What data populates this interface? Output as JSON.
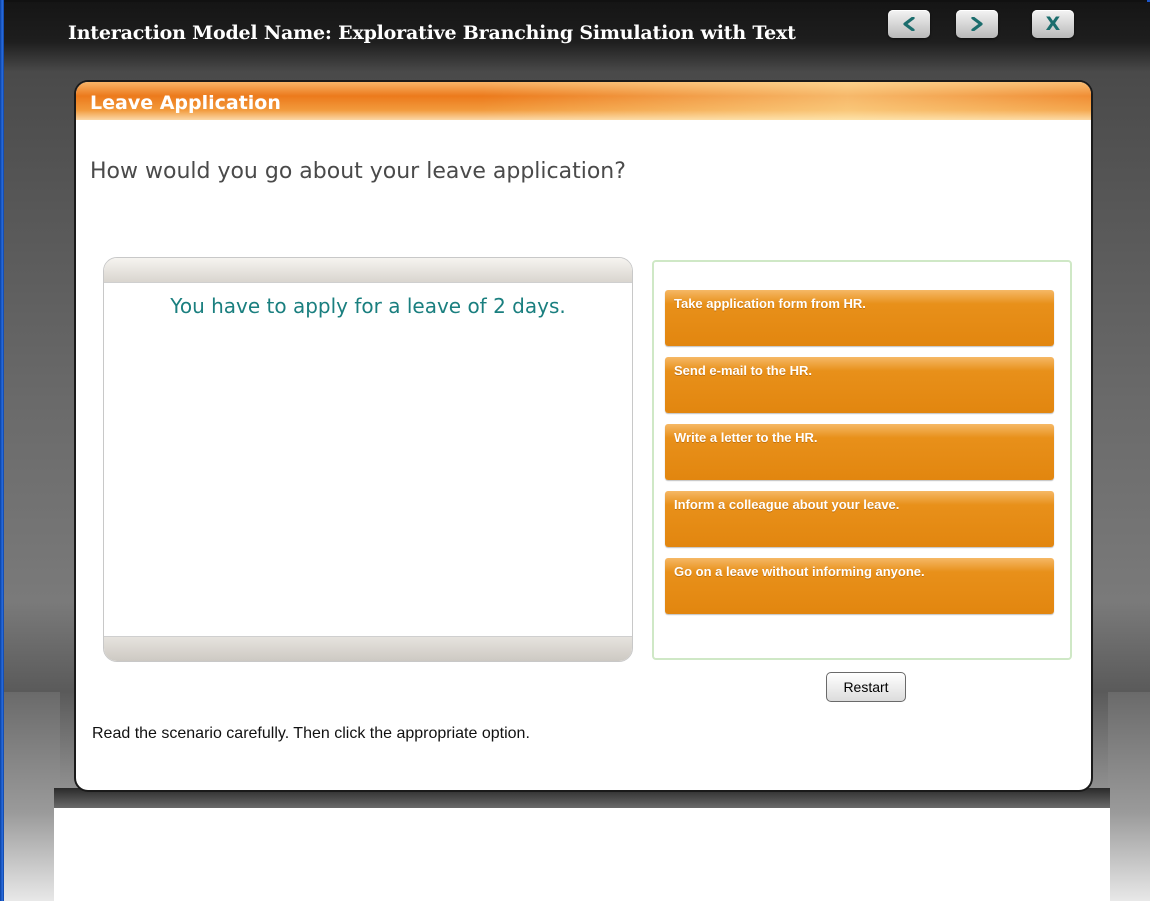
{
  "window": {
    "title": "Interaction Model Name: Explorative Branching Simulation with Text",
    "prev_icon": "chevron-left-icon",
    "next_icon": "chevron-right-icon",
    "close_label": "X"
  },
  "panel": {
    "title": "Leave Application",
    "question": "How would you go about your leave application?",
    "scenario": "You have to apply for a leave of 2 days.",
    "options": [
      "Take application form from HR.",
      "Send e-mail to the HR.",
      "Write a letter to the HR.",
      "Inform a colleague about your leave.",
      "Go on a leave without informing anyone."
    ],
    "restart_label": "Restart",
    "instruction": "Read the scenario carefully. Then click the appropriate option."
  },
  "colors": {
    "accent_orange": "#e8901a",
    "scenario_text": "#1a7f7f",
    "options_border": "#cfe8c6"
  }
}
